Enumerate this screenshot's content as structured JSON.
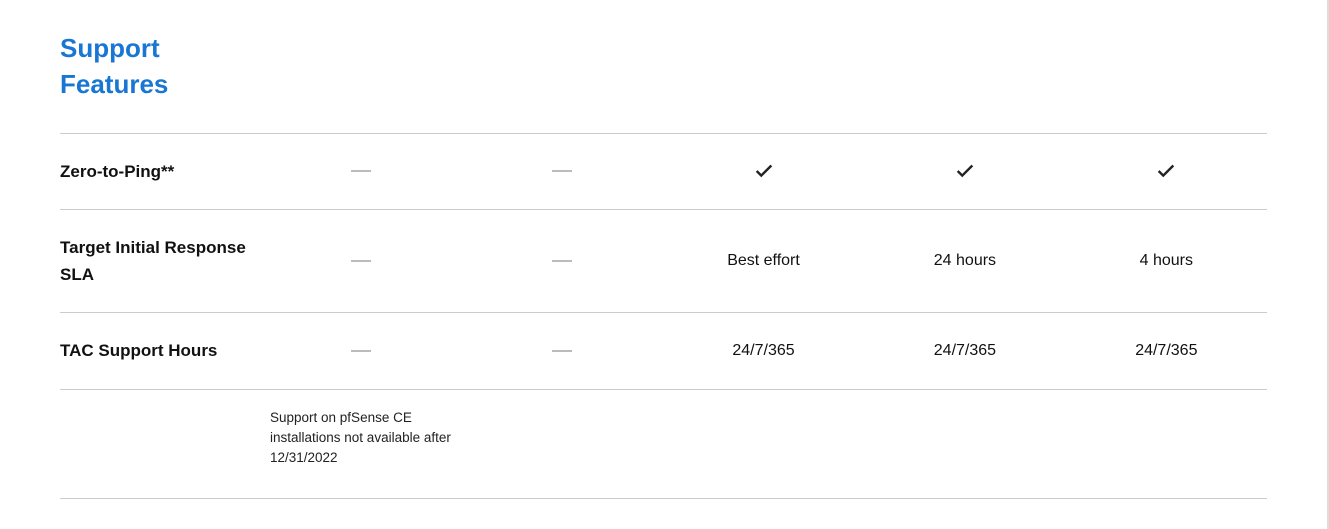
{
  "section_title": "Support Features",
  "rows": [
    {
      "label": "Zero-to-Ping**",
      "cells": [
        {
          "type": "dash"
        },
        {
          "type": "dash"
        },
        {
          "type": "check"
        },
        {
          "type": "check"
        },
        {
          "type": "check"
        }
      ]
    },
    {
      "label": "Target Initial Response SLA",
      "cells": [
        {
          "type": "dash"
        },
        {
          "type": "dash"
        },
        {
          "type": "text",
          "value": "Best effort"
        },
        {
          "type": "text",
          "value": "24 hours"
        },
        {
          "type": "text",
          "value": "4 hours"
        }
      ]
    },
    {
      "label": "TAC Support Hours",
      "cells": [
        {
          "type": "dash"
        },
        {
          "type": "dash"
        },
        {
          "type": "text",
          "value": "24/7/365"
        },
        {
          "type": "text",
          "value": "24/7/365"
        },
        {
          "type": "text",
          "value": "24/7/365"
        }
      ]
    }
  ],
  "footnote": {
    "col_index": 0,
    "text": "Support on pfSense CE installations not available after 12/31/2022"
  }
}
